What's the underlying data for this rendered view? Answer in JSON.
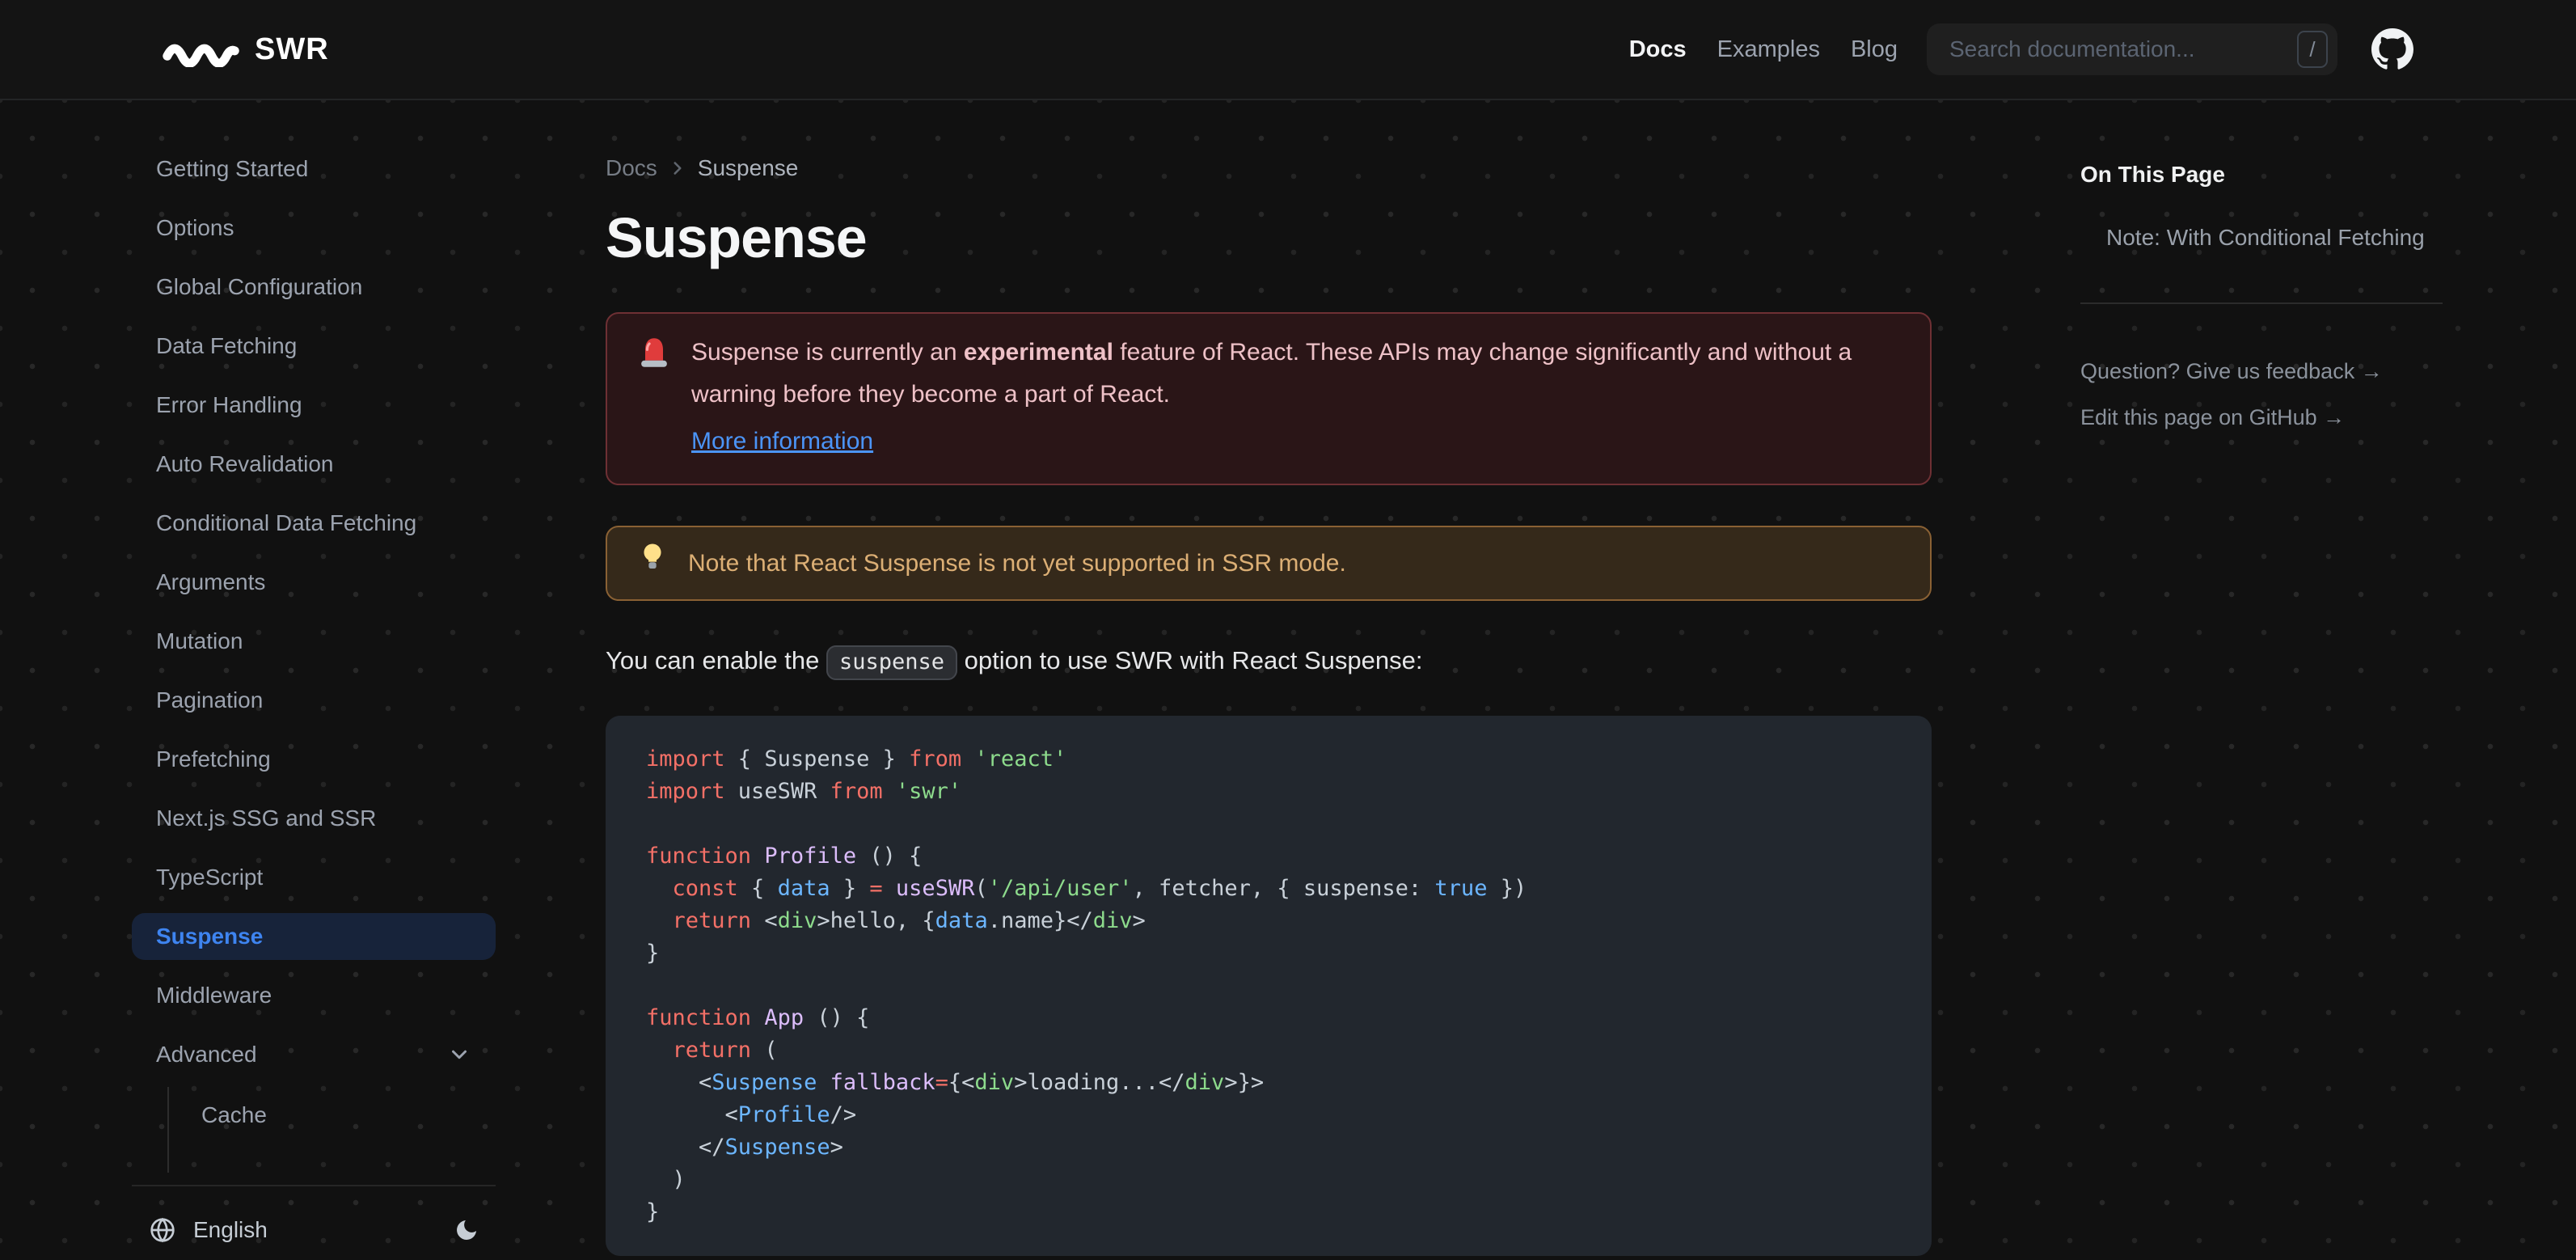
{
  "navbar": {
    "logo_text": "SWR",
    "links": [
      {
        "label": "Docs",
        "active": true
      },
      {
        "label": "Examples",
        "active": false
      },
      {
        "label": "Blog",
        "active": false
      }
    ],
    "search_placeholder": "Search documentation...",
    "search_shortcut": "/"
  },
  "sidebar": {
    "items": [
      {
        "label": "Getting Started"
      },
      {
        "label": "Options"
      },
      {
        "label": "Global Configuration"
      },
      {
        "label": "Data Fetching"
      },
      {
        "label": "Error Handling"
      },
      {
        "label": "Auto Revalidation"
      },
      {
        "label": "Conditional Data Fetching"
      },
      {
        "label": "Arguments"
      },
      {
        "label": "Mutation"
      },
      {
        "label": "Pagination"
      },
      {
        "label": "Prefetching"
      },
      {
        "label": "Next.js SSG and SSR"
      },
      {
        "label": "TypeScript"
      },
      {
        "label": "Suspense",
        "active": true
      },
      {
        "label": "Middleware"
      },
      {
        "label": "Advanced",
        "expandable": true,
        "children": [
          "Cache"
        ]
      }
    ],
    "footer": {
      "language": "English"
    }
  },
  "breadcrumb": [
    "Docs",
    "Suspense"
  ],
  "page": {
    "title": "Suspense"
  },
  "callouts": {
    "error": {
      "icon": "siren-icon",
      "text_parts": [
        {
          "t": "Suspense is currently an "
        },
        {
          "t": "experimental",
          "b": true
        },
        {
          "t": " feature of React. These APIs may change significantly and without a warning before they become a part of React."
        }
      ],
      "link": "More information"
    },
    "warning": {
      "icon": "bulb-icon",
      "text": "Note that React Suspense is not yet supported in SSR mode."
    }
  },
  "para": {
    "before": "You can enable the ",
    "code": "suspense",
    "after": " option to use SWR with React Suspense:"
  },
  "code": {
    "lines": [
      [
        {
          "t": "import",
          "c": "k"
        },
        {
          "t": " { Suspense } ",
          "c": "p"
        },
        {
          "t": "from",
          "c": "k"
        },
        {
          "t": " ",
          "c": "p"
        },
        {
          "t": "'react'",
          "c": "s"
        }
      ],
      [
        {
          "t": "import",
          "c": "k"
        },
        {
          "t": " useSWR ",
          "c": "p"
        },
        {
          "t": "from",
          "c": "k"
        },
        {
          "t": " ",
          "c": "p"
        },
        {
          "t": "'swr'",
          "c": "s"
        }
      ],
      [],
      [
        {
          "t": "function",
          "c": "k"
        },
        {
          "t": " ",
          "c": "p"
        },
        {
          "t": "Profile",
          "c": "f"
        },
        {
          "t": " () {",
          "c": "p"
        }
      ],
      [
        {
          "t": "  ",
          "c": "p"
        },
        {
          "t": "const",
          "c": "k"
        },
        {
          "t": " { ",
          "c": "p"
        },
        {
          "t": "data",
          "c": "v"
        },
        {
          "t": " } ",
          "c": "p"
        },
        {
          "t": "=",
          "c": "k"
        },
        {
          "t": " ",
          "c": "p"
        },
        {
          "t": "useSWR",
          "c": "f"
        },
        {
          "t": "(",
          "c": "p"
        },
        {
          "t": "'/api/user'",
          "c": "s"
        },
        {
          "t": ", fetcher, { suspense: ",
          "c": "p"
        },
        {
          "t": "true",
          "c": "v"
        },
        {
          "t": " })",
          "c": "p"
        }
      ],
      [
        {
          "t": "  ",
          "c": "p"
        },
        {
          "t": "return",
          "c": "k"
        },
        {
          "t": " <",
          "c": "p"
        },
        {
          "t": "div",
          "c": "g"
        },
        {
          "t": ">hello, {",
          "c": "p"
        },
        {
          "t": "data",
          "c": "v"
        },
        {
          "t": ".name}</",
          "c": "p"
        },
        {
          "t": "div",
          "c": "g"
        },
        {
          "t": ">",
          "c": "p"
        }
      ],
      [
        {
          "t": "}",
          "c": "p"
        }
      ],
      [],
      [
        {
          "t": "function",
          "c": "k"
        },
        {
          "t": " ",
          "c": "p"
        },
        {
          "t": "App",
          "c": "f"
        },
        {
          "t": " () {",
          "c": "p"
        }
      ],
      [
        {
          "t": "  ",
          "c": "p"
        },
        {
          "t": "return",
          "c": "k"
        },
        {
          "t": " (",
          "c": "p"
        }
      ],
      [
        {
          "t": "    <",
          "c": "p"
        },
        {
          "t": "Suspense",
          "c": "v"
        },
        {
          "t": " ",
          "c": "p"
        },
        {
          "t": "fallback",
          "c": "f"
        },
        {
          "t": "=",
          "c": "k"
        },
        {
          "t": "{<",
          "c": "p"
        },
        {
          "t": "div",
          "c": "g"
        },
        {
          "t": ">loading...</",
          "c": "p"
        },
        {
          "t": "div",
          "c": "g"
        },
        {
          "t": ">}>",
          "c": "p"
        }
      ],
      [
        {
          "t": "      <",
          "c": "p"
        },
        {
          "t": "Profile",
          "c": "v"
        },
        {
          "t": "/>",
          "c": "p"
        }
      ],
      [
        {
          "t": "    </",
          "c": "p"
        },
        {
          "t": "Suspense",
          "c": "v"
        },
        {
          "t": ">",
          "c": "p"
        }
      ],
      [
        {
          "t": "  )",
          "c": "p"
        }
      ],
      [
        {
          "t": "}",
          "c": "p"
        }
      ]
    ]
  },
  "toc": {
    "title": "On This Page",
    "items": [
      "Note: With Conditional Fetching"
    ],
    "links": [
      "Question? Give us feedback →",
      "Edit this page on GitHub →"
    ]
  },
  "colors": {
    "accent_blue": "#3e84f0",
    "active_item_bg": "#17233a",
    "error_bg": "#2a1517",
    "error_border": "#6e3034",
    "error_text": "#eec1c7",
    "warning_bg": "#35291a",
    "warning_border": "#8a6134",
    "warning_text": "#dcaf75",
    "code_bg": "#22272e",
    "token_keyword": "#f47067",
    "token_string": "#8ddb8c",
    "token_tag": "#8ddb8c",
    "token_function": "#dcbdfb",
    "token_variable": "#6cb6ff",
    "token_plain": "#c9d1d9"
  }
}
